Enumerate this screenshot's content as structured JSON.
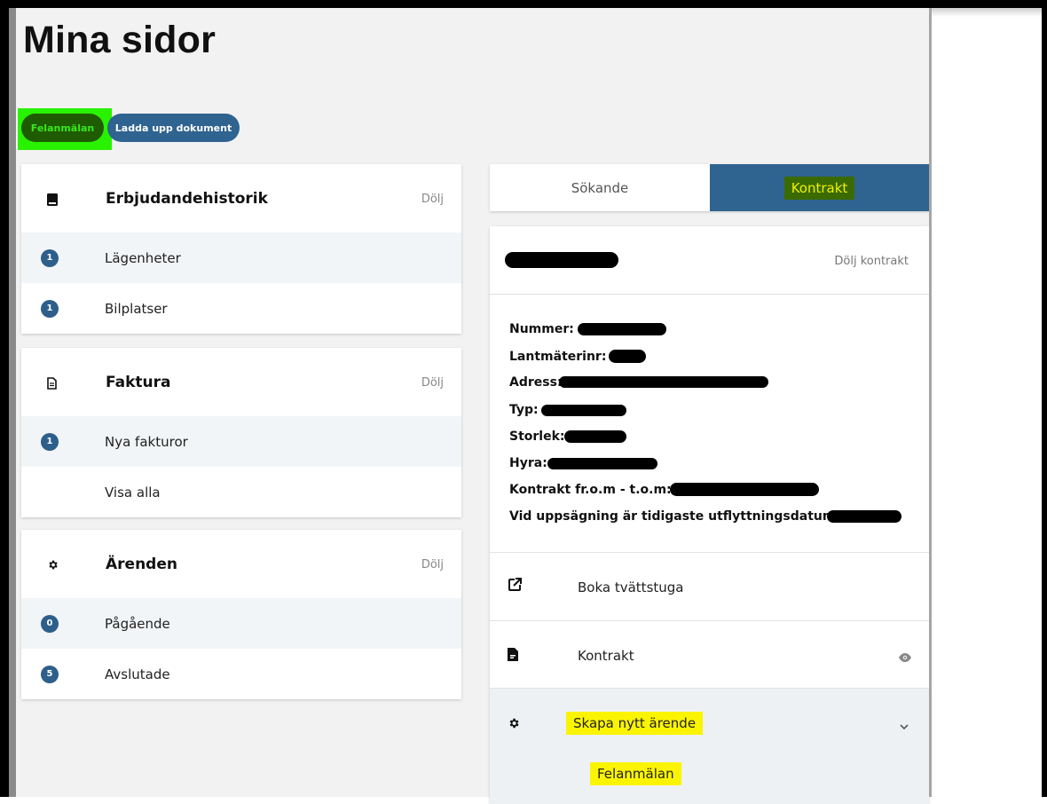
{
  "page": {
    "title": "Mina sidor"
  },
  "top_buttons": {
    "felanmalan": "Felanmälan",
    "ladda_upp": "Ladda upp dokument"
  },
  "cards": {
    "erbjudande": {
      "title": "Erbjudandehistorik",
      "toggle": "Dölj",
      "icon": "book-icon",
      "rows": [
        {
          "count": "1",
          "label": "Lägenheter"
        },
        {
          "count": "1",
          "label": "Bilplatser"
        }
      ]
    },
    "faktura": {
      "title": "Faktura",
      "toggle": "Dölj",
      "icon": "document-icon",
      "rows": [
        {
          "count": "1",
          "label": "Nya fakturor"
        },
        {
          "label": "Visa alla"
        }
      ]
    },
    "arenden": {
      "title": "Ärenden",
      "toggle": "Dölj",
      "icon": "gear-icon",
      "rows": [
        {
          "count": "0",
          "label": "Pågående"
        },
        {
          "count": "5",
          "label": "Avslutade"
        }
      ]
    }
  },
  "tabs": {
    "sokande": "Sökande",
    "kontrakt": "Kontrakt"
  },
  "contract": {
    "toggle": "Dölj kontrakt",
    "fields": {
      "nummer": "Nummer:",
      "lantmaterinr": "Lantmäterinr:",
      "adress": "Adress:",
      "typ": "Typ:",
      "storlek": "Storlek:",
      "hyra": "Hyra:",
      "kontrakt_period": "Kontrakt fr.o.m - t.o.m:",
      "uppsagning": "Vid uppsägning är tidigaste utflyttningsdatum:"
    },
    "actions": {
      "boka": "Boka tvättstuga",
      "kontrakt": "Kontrakt",
      "skapa": "Skapa nytt ärende",
      "felanmalan": "Felanmälan"
    }
  },
  "colors": {
    "primary": "#2f6390",
    "highlight_green": "#29f200",
    "highlight_yellow": "#fbf400"
  }
}
